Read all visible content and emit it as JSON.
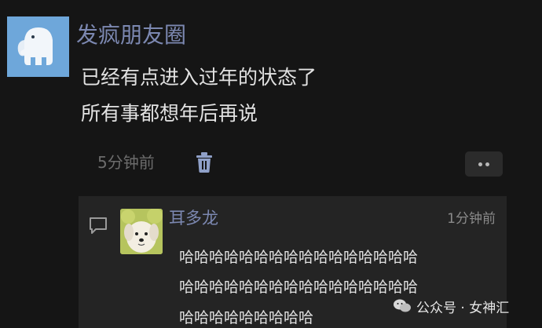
{
  "post": {
    "username": "发疯朋友圈",
    "content_lines": [
      "已经有点进入过年的状态了",
      "所有事都想年后再说"
    ],
    "time": "5分钟前",
    "icons": {
      "avatar": "white-elephant-avatar",
      "delete": "trash-icon",
      "more": "more-dots-icon"
    }
  },
  "comment": {
    "name": "耳多龙",
    "time": "1分钟前",
    "lines": [
      "哈哈哈哈哈哈哈哈哈哈哈哈哈哈哈哈",
      "哈哈哈哈哈哈哈哈哈哈哈哈哈哈哈哈",
      "哈哈哈哈哈哈哈哈哈"
    ],
    "icons": {
      "comment": "comment-bubble-icon",
      "avatar": "dog-avatar"
    }
  },
  "watermark": {
    "text": "公众号 · 女神汇",
    "icon": "wechat-icon"
  },
  "colors": {
    "background": "#151515",
    "name": "#7c88b1",
    "text": "#e2e2e2",
    "muted": "#6c6c6c",
    "panel": "#242424"
  }
}
